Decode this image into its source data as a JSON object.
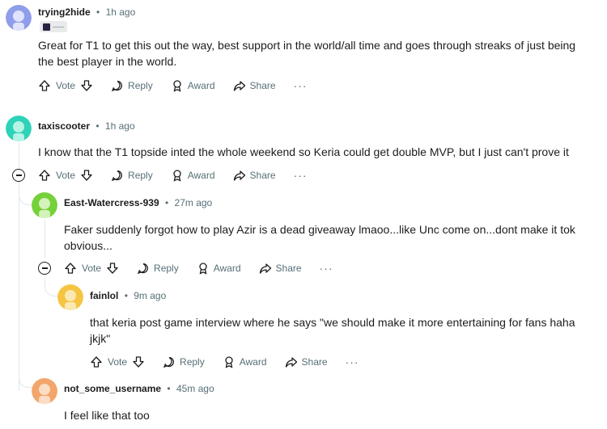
{
  "comments": [
    {
      "username": "trying2hide",
      "time": "1h ago",
      "flair_text": "——",
      "body": "Great for T1 to get this out the way, best support in the world/all time and goes through streaks of just being the best player in the world.",
      "avatar_color": "#8f9dea"
    },
    {
      "username": "taxiscooter",
      "time": "1h ago",
      "body": "I know that the T1 topside inted the whole weekend so Keria could get double MVP, but I just can't prove it",
      "avatar_color": "#2ed3b7"
    },
    {
      "username": "East-Watercress-939",
      "time": "27m ago",
      "body": "Faker suddenly forgot how to play Azir is a dead giveaway lmaoo...like Unc come on...dont make it tok obvious...",
      "avatar_color": "#75d13a"
    },
    {
      "username": "fainlol",
      "time": "9m ago",
      "body": "that keria post game interview where he says \"we should make it more entertaining for fans haha jkjk\"",
      "avatar_color": "#f5c542"
    },
    {
      "username": "not_some_username",
      "time": "45m ago",
      "body": "I feel like that too",
      "avatar_color": "#f2a66b"
    }
  ],
  "actions": {
    "vote": "Vote",
    "reply": "Reply",
    "award": "Award",
    "share": "Share",
    "more": "···"
  },
  "separator": "•"
}
